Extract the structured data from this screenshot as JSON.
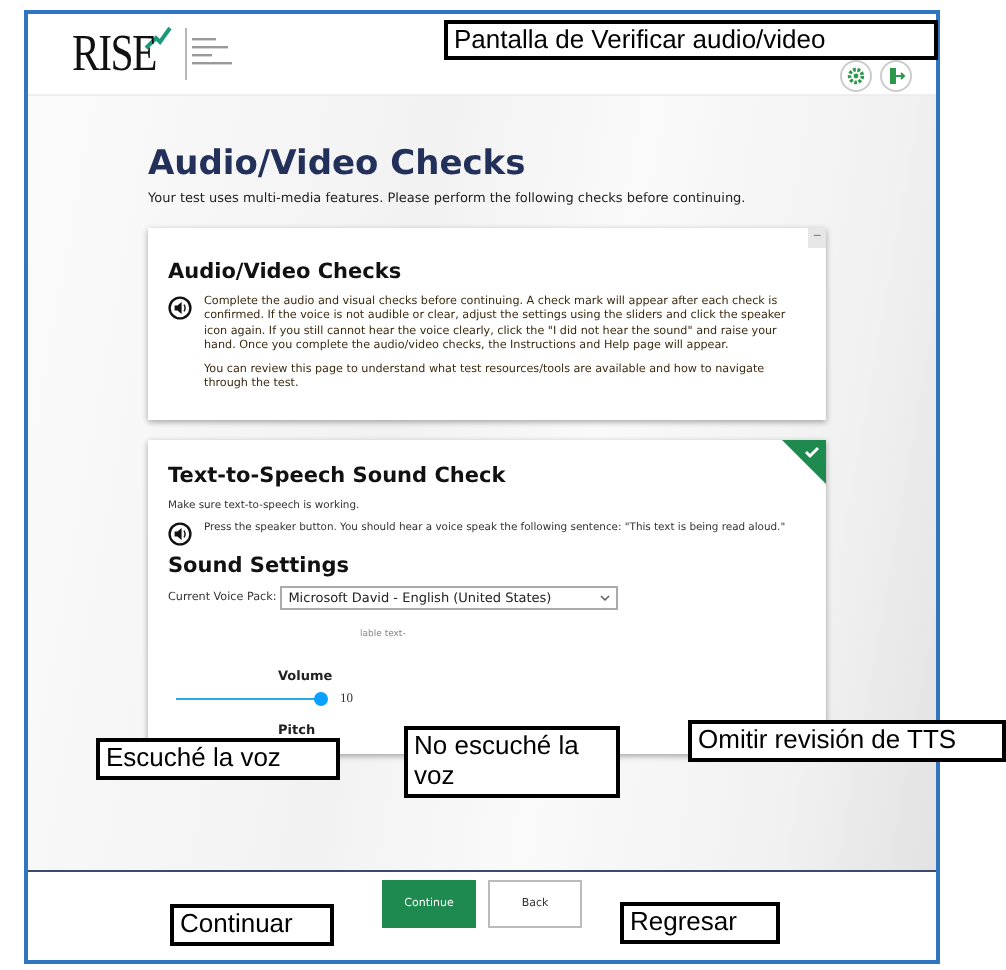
{
  "header": {
    "logo": "RISE"
  },
  "page": {
    "title": "Audio/Video Checks",
    "subtitle": "Your test uses multi-media features. Please perform the following checks before continuing."
  },
  "info_card": {
    "collapse": "−",
    "title": "Audio/Video Checks",
    "paragraphs": [
      "Complete the audio and visual checks before continuing. A check mark will appear after each check is confirmed. If the voice is not audible or clear, adjust the settings using the sliders and click the speaker icon again. If you still cannot hear the voice clearly, click the \"I did not hear the sound\" and raise your hand. Once you complete the audio/video checks, the Instructions and Help page will appear.",
      "You can review this page to understand what test resources/tools are available and how to navigate through the test."
    ]
  },
  "tts_card": {
    "checked": true,
    "title": "Text-to-Speech Sound Check",
    "intro": "Make sure text-to-speech is working.",
    "prompt": "Press the speaker button. You should hear a voice speak the following sentence: \"This text is being read aloud.\"",
    "settings_title": "Sound Settings",
    "voice_label": "Current Voice Pack:",
    "voice_value": "Microsoft David - English (United States)",
    "fragment": "lable text-",
    "volume": {
      "label": "Volume",
      "level": 1,
      "reading": "10"
    },
    "pitch_label": "Pitch"
  },
  "buttons": [
    {
      "label": "Continue",
      "kind": "primary"
    },
    {
      "label": "Back",
      "kind": "secondary"
    }
  ],
  "callouts": [
    "Pantalla de Verificar audio/video",
    "Escuché la voz",
    "No escuché la voz",
    "Omitir revisión de TTS",
    "Continuar",
    "Regresar"
  ]
}
